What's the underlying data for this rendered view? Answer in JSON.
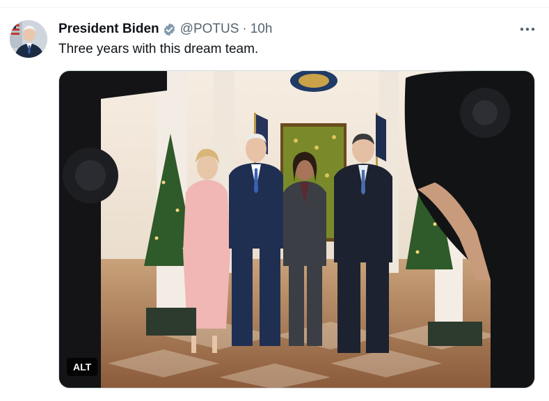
{
  "tweet": {
    "author_name": "President Biden",
    "handle": "@POTUS",
    "separator": "·",
    "time": "10h",
    "text": "Three years with this dream team.",
    "verified": true,
    "verified_color": "#829aab"
  },
  "media": {
    "alt_label": "ALT",
    "kind": "photo"
  },
  "icons": {
    "verified": "verified-badge-icon",
    "more": "more-options-icon"
  }
}
